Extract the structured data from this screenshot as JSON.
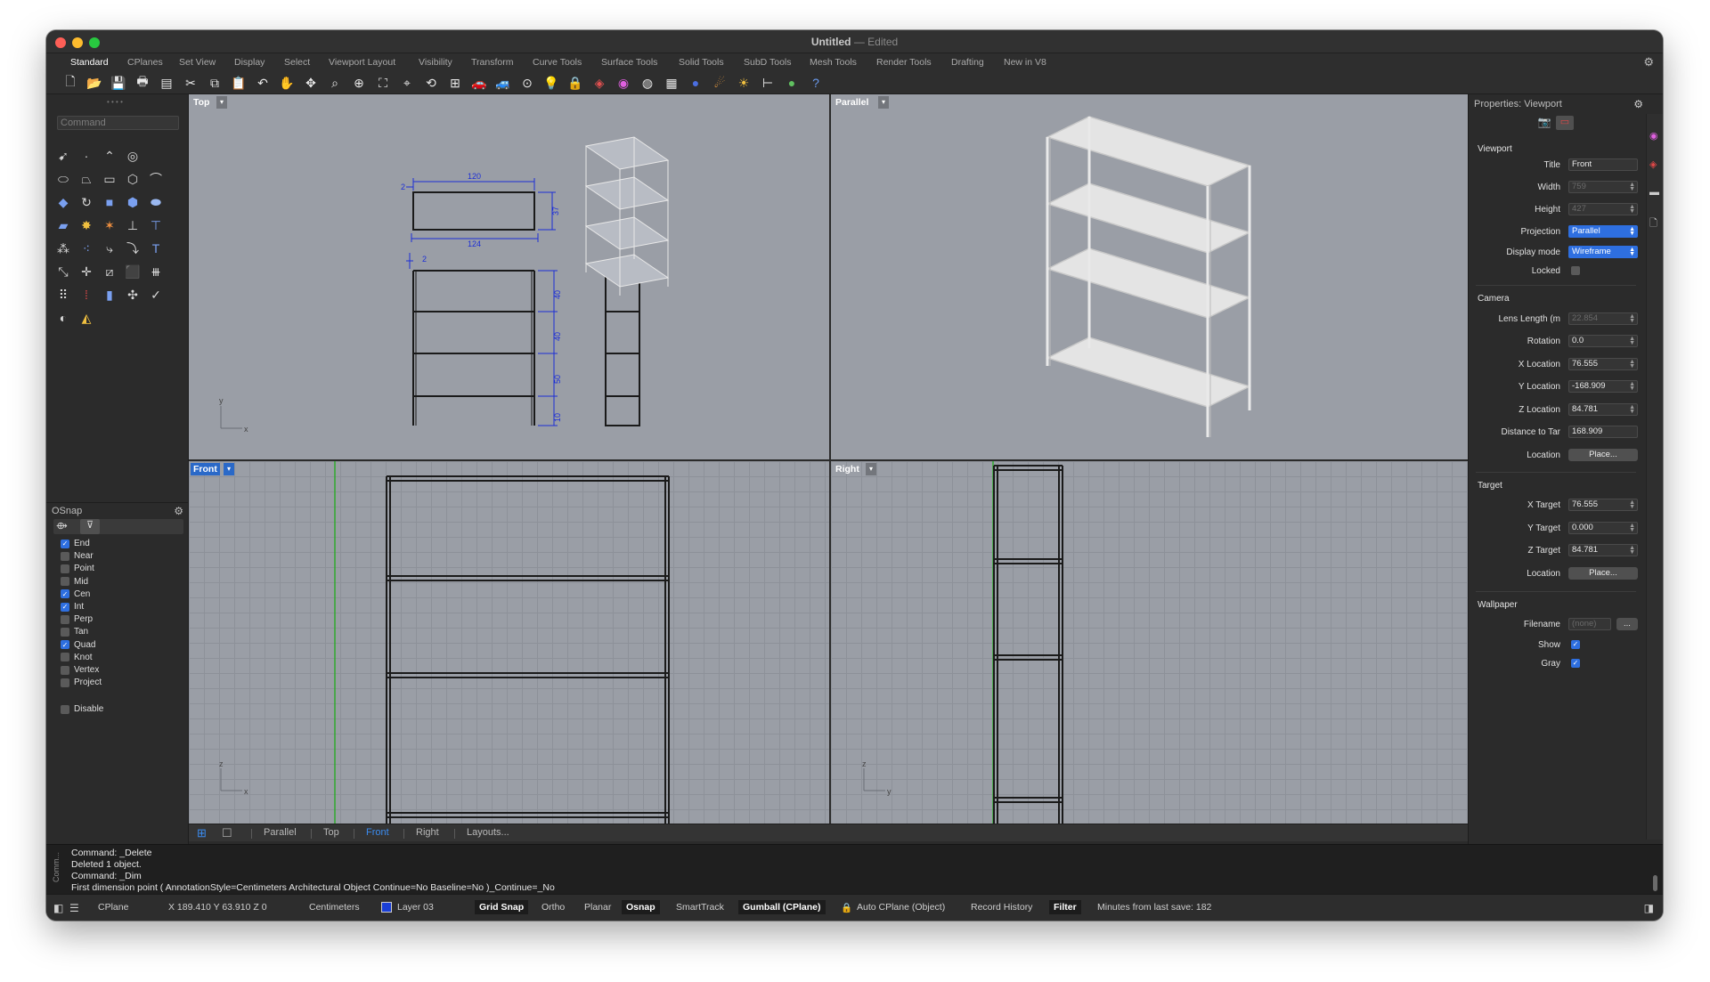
{
  "window": {
    "title": "Untitled",
    "title_suffix": "— Edited"
  },
  "tabs": [
    "Standard",
    "CPlanes",
    "Set View",
    "Display",
    "Select",
    "Viewport Layout",
    "Visibility",
    "Transform",
    "Curve Tools",
    "Surface Tools",
    "Solid Tools",
    "SubD Tools",
    "Mesh Tools",
    "Render Tools",
    "Drafting",
    "New in V8"
  ],
  "active_tab": "Standard",
  "command": {
    "placeholder": "Command"
  },
  "osnap": {
    "title": "OSnap",
    "items": [
      {
        "label": "End",
        "checked": true
      },
      {
        "label": "Near",
        "checked": false
      },
      {
        "label": "Point",
        "checked": false
      },
      {
        "label": "Mid",
        "checked": false
      },
      {
        "label": "Cen",
        "checked": true
      },
      {
        "label": "Int",
        "checked": true
      },
      {
        "label": "Perp",
        "checked": false
      },
      {
        "label": "Tan",
        "checked": false
      },
      {
        "label": "Quad",
        "checked": true
      },
      {
        "label": "Knot",
        "checked": false
      },
      {
        "label": "Vertex",
        "checked": false
      },
      {
        "label": "Project",
        "checked": false
      }
    ],
    "disable": "Disable"
  },
  "viewports": {
    "top": {
      "label": "Top",
      "dims": {
        "w_top": "120",
        "w_bot": "124",
        "depth": "37",
        "off1": "2",
        "off2": "2",
        "h1": "40",
        "h2": "40",
        "h3": "50",
        "h4": "10"
      },
      "axis_y": "y",
      "axis_x": "x"
    },
    "parallel": {
      "label": "Parallel"
    },
    "front": {
      "label": "Front",
      "axis_y": "z",
      "axis_x": "x"
    },
    "right": {
      "label": "Right",
      "axis_y": "z",
      "axis_x": "y"
    }
  },
  "viewport_tabs": [
    "Parallel",
    "Top",
    "Front",
    "Right",
    "Layouts..."
  ],
  "active_viewport_tab": "Front",
  "properties": {
    "header": "Properties: Viewport",
    "viewport_section": "Viewport",
    "title_label": "Title",
    "title_value": "Front",
    "width_label": "Width",
    "width_value": "759",
    "height_label": "Height",
    "height_value": "427",
    "projection_label": "Projection",
    "projection_value": "Parallel",
    "display_label": "Display mode",
    "display_value": "Wireframe",
    "locked_label": "Locked",
    "camera_section": "Camera",
    "lens_label": "Lens Length (m",
    "lens_value": "22.854",
    "rotation_label": "Rotation",
    "rotation_value": "0.0",
    "xloc_label": "X Location",
    "xloc_value": "76.555",
    "yloc_label": "Y Location",
    "yloc_value": "-168.909",
    "zloc_label": "Z Location",
    "zloc_value": "84.781",
    "dist_label": "Distance to Tar",
    "dist_value": "168.909",
    "location_label": "Location",
    "place_label": "Place...",
    "target_section": "Target",
    "xt_label": "X Target",
    "xt_value": "76.555",
    "yt_label": "Y Target",
    "yt_value": "0.000",
    "zt_label": "Z Target",
    "zt_value": "84.781",
    "tlocation_label": "Location",
    "tplace_label": "Place...",
    "wallpaper_section": "Wallpaper",
    "filename_label": "Filename",
    "filename_value": "(none)",
    "browse_label": "...",
    "show_label": "Show",
    "gray_label": "Gray"
  },
  "command_history": {
    "label": "Comm...",
    "lines": [
      "Command: _Delete",
      "Deleted 1 object.",
      "Command: _Dim",
      "First dimension point ( AnnotationStyle=Centimeters Architectural Object Continue=No Baseline=No )_Continue=_No"
    ]
  },
  "status": {
    "cplane": "CPlane",
    "coords": "X 189.410 Y 63.910 Z 0",
    "units": "Centimeters",
    "layer": "Layer 03",
    "grid_snap": "Grid Snap",
    "ortho": "Ortho",
    "planar": "Planar",
    "osnap": "Osnap",
    "smarttrack": "SmartTrack",
    "gumball": "Gumball (CPlane)",
    "auto_cplane": "Auto CPlane (Object)",
    "record_history": "Record History",
    "filter": "Filter",
    "minutes": "Minutes from last save: 182"
  },
  "colors": {
    "accent": "#2e6fe0",
    "viewport_bg": "#9a9ea6",
    "active_label": "#2a69c8",
    "dim_blue": "#1c2ed6",
    "layer_swatch": "#1a3fd6"
  }
}
